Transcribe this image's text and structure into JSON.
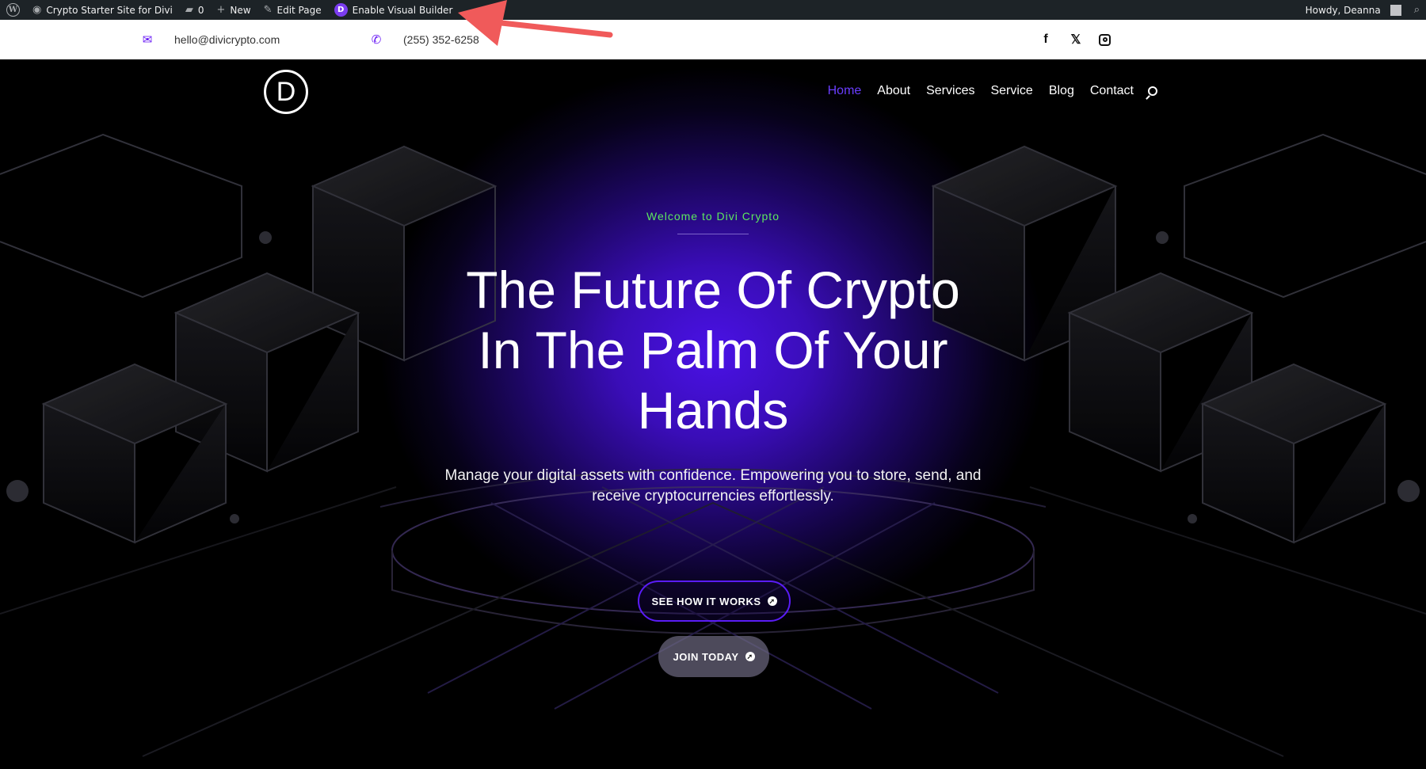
{
  "adminbar": {
    "site_name": "Crypto Starter Site for Divi",
    "comments_count": "0",
    "new_label": "New",
    "edit_label": "Edit Page",
    "visual_builder_label": "Enable Visual Builder",
    "howdy": "Howdy, Deanna"
  },
  "topbar": {
    "email": "hello@divicrypto.com",
    "phone": "(255) 352-6258"
  },
  "nav": {
    "logo_letter": "D",
    "items": [
      {
        "label": "Home",
        "active": true
      },
      {
        "label": "About"
      },
      {
        "label": "Services"
      },
      {
        "label": "Service"
      },
      {
        "label": "Blog"
      },
      {
        "label": "Contact"
      }
    ]
  },
  "hero": {
    "eyebrow": "Welcome to Divi Crypto",
    "headline_line1": "The Future Of Crypto",
    "headline_line2": "In The Palm Of Your",
    "headline_line3": "Hands",
    "subtitle": "Manage your digital assets with confidence. Empowering you to store, send, and receive cryptocurrencies effortlessly.",
    "primary_button": "SEE HOW IT WORKS",
    "secondary_button": "JOIN TODAY"
  },
  "colors": {
    "accent": "#6514f5",
    "active_nav": "#6a3dff",
    "eyebrow": "#5de85f",
    "annotation_arrow": "#f05a5a"
  }
}
